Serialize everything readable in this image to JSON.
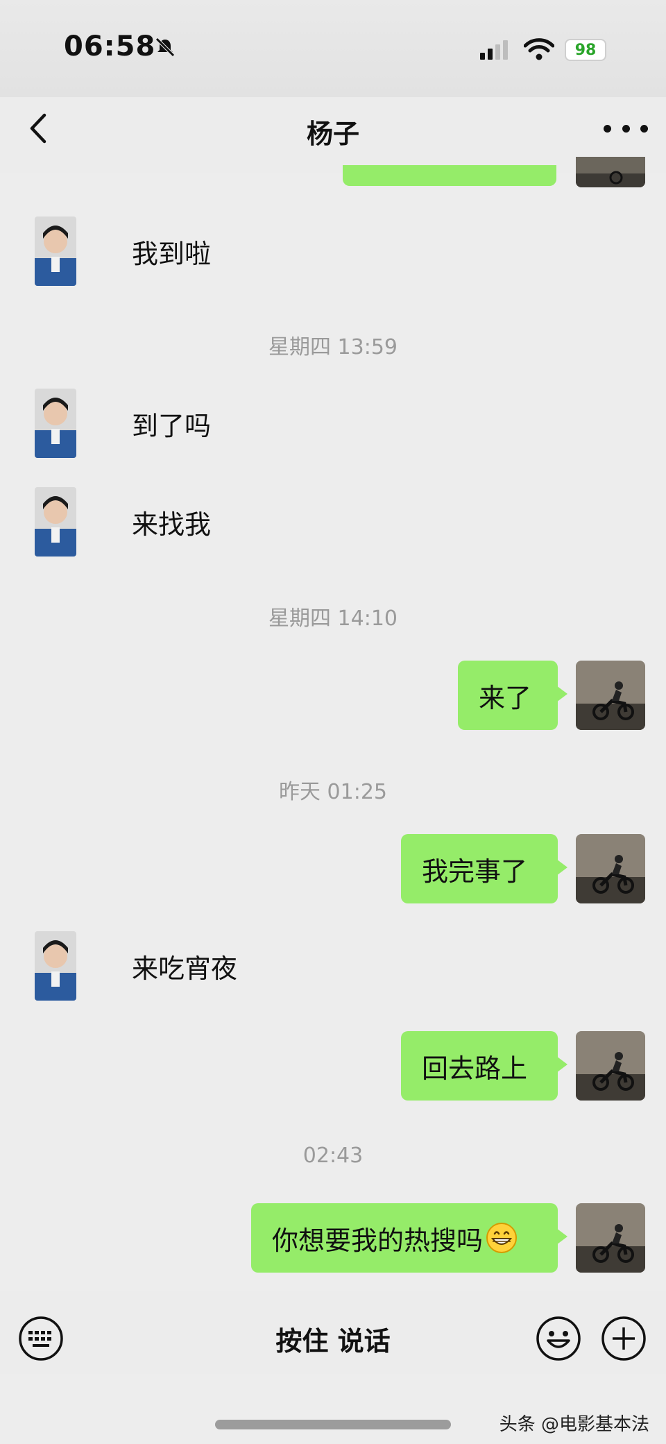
{
  "status_bar": {
    "time": "06:58",
    "battery": "98"
  },
  "nav": {
    "title": "杨子"
  },
  "messages": [
    {
      "side": "left",
      "text": "我到啦"
    },
    {
      "timestamp": "星期四 13:59"
    },
    {
      "side": "left",
      "text": "到了吗"
    },
    {
      "side": "left",
      "text": "来找我"
    },
    {
      "timestamp": "星期四 14:10"
    },
    {
      "side": "right",
      "text": "来了"
    },
    {
      "timestamp": "昨天 01:25"
    },
    {
      "side": "right",
      "text": "我完事了"
    },
    {
      "side": "left",
      "text": "来吃宵夜"
    },
    {
      "side": "right",
      "text": "回去路上"
    },
    {
      "timestamp": "02:43"
    },
    {
      "side": "right",
      "text": "你想要我的热搜吗",
      "emoji": "grinning-face-icon"
    }
  ],
  "input_bar": {
    "hold_to_talk_label": "按住 说话"
  },
  "watermark": {
    "text": "头条 @电影基本法"
  },
  "colors": {
    "bubble_green": "#95ec69",
    "background": "#ededed"
  }
}
